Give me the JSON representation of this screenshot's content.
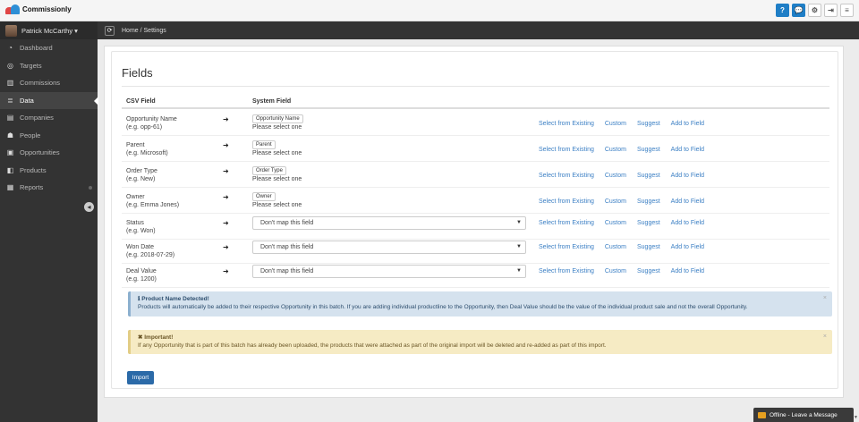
{
  "app": {
    "name": "Commissionly"
  },
  "topbar": {
    "help_label": "?",
    "chat_label": "💬",
    "settings_label": "⚙",
    "logout_label": "⇥",
    "menu_label": "≡"
  },
  "sidebar": {
    "user_name": "Patrick McCarthy ▾",
    "items": [
      {
        "label": "Dashboard",
        "icon": "dashboard-icon",
        "glyph": "◔"
      },
      {
        "label": "Targets",
        "icon": "target-icon",
        "glyph": "◎"
      },
      {
        "label": "Commissions",
        "icon": "bar-chart-icon",
        "glyph": "▥"
      },
      {
        "label": "Data",
        "icon": "database-icon",
        "glyph": "≣"
      },
      {
        "label": "Companies",
        "icon": "building-icon",
        "glyph": "▤"
      },
      {
        "label": "People",
        "icon": "people-icon",
        "glyph": "☗"
      },
      {
        "label": "Opportunities",
        "icon": "money-icon",
        "glyph": "▣"
      },
      {
        "label": "Products",
        "icon": "cube-icon",
        "glyph": "◧"
      },
      {
        "label": "Reports",
        "icon": "grid-icon",
        "glyph": "▦"
      }
    ],
    "collapse_label": "◂"
  },
  "breadcrumb": {
    "refresh_icon": "⟳",
    "path": "Home /  Settings"
  },
  "page": {
    "title": "Fields",
    "col_csv": "CSV Field",
    "col_system": "System Field",
    "arrow": "➜",
    "rows": [
      {
        "csv": "Opportunity Name",
        "example": "(e.g. opp-61)",
        "chip": "Opportunity Name",
        "hint": "Please select one"
      },
      {
        "csv": "Parent",
        "example": "(e.g. Microsoft)",
        "chip": "Parent",
        "hint": "Please select one"
      },
      {
        "csv": "Order Type",
        "example": "(e.g. New)",
        "chip": "Order Type",
        "hint": "Please select one"
      },
      {
        "csv": "Owner",
        "example": "(e.g. Emma Jones)",
        "chip": "Owner",
        "hint": "Please select one"
      },
      {
        "csv": "Status",
        "example": "(e.g. Won)",
        "select": "Don't map this field"
      },
      {
        "csv": "Won Date",
        "example": "(e.g. 2018-07-29)",
        "select": "Don't map this field"
      },
      {
        "csv": "Deal Value",
        "example": "(e.g. 1200)",
        "select": "Don't map this field"
      }
    ],
    "actions": [
      "Select from Existing",
      "Custom",
      "Suggest",
      "Add to Field"
    ],
    "info_alert": {
      "title": "ℹ  Product Name Detected!",
      "text": "Products will automatically be added to their respective Opportunity in this batch.    If you are adding individual productline to the Opportunity, then Deal Value should be the value of the individual product sale and not the overall Opportunity."
    },
    "warn_alert": {
      "title": "✖ Important!",
      "text": "If any Opportunity that is part of this batch has already been uploaded, the products that were attached as part of the original import will be deleted and re-added as part of this import."
    },
    "close_label": "×",
    "import_label": "Import"
  },
  "chat": {
    "label": "Offline - Leave a Message"
  }
}
